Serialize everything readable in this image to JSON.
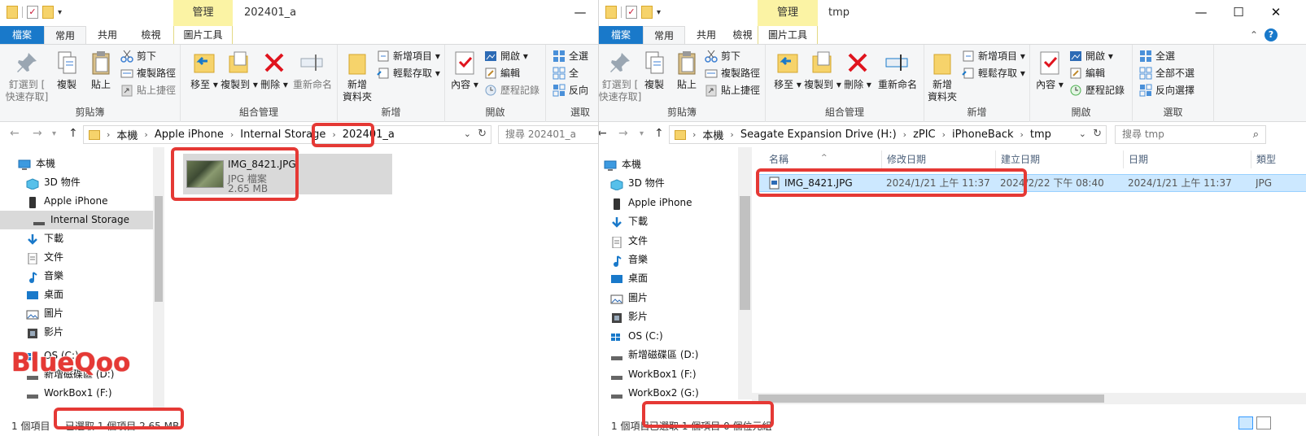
{
  "colors": {
    "accent": "#1979ca",
    "manage_bg": "#fbf3a4",
    "highlight": "#e53935",
    "selection": "#cce8ff"
  },
  "watermark": "BlueQoo",
  "common": {
    "tab_file": "檔案",
    "tab_home": "常用",
    "tab_share": "共用",
    "tab_view": "檢視",
    "tab_picture_tools": "圖片工具",
    "manage": "管理",
    "clipboard": {
      "pin": "釘選到 [",
      "pin2": "快速存取]",
      "copy": "複製",
      "paste": "貼上",
      "cut": "剪下",
      "copy_path": "複製路徑",
      "paste_shortcut": "貼上捷徑",
      "label": "剪貼簿"
    },
    "organize": {
      "move_to": "移至",
      "copy_to": "複製到",
      "delete": "刪除",
      "rename": "重新命名",
      "label": "組合管理"
    },
    "new": {
      "new_folder": "新增",
      "new_folder2": "資料夾",
      "new_item": "新增項目",
      "easy_access": "輕鬆存取",
      "label": "新增"
    },
    "open": {
      "properties": "內容",
      "open": "開啟",
      "edit": "編輯",
      "history": "歷程記錄",
      "label": "開啟"
    },
    "select": {
      "select_all": "全選",
      "select_none": "全部不選",
      "invert": "反向選擇",
      "label": "選取"
    },
    "nav": {
      "this_pc": "本機",
      "3d": "3D 物件",
      "iphone": "Apple iPhone",
      "internal": "Internal Storage",
      "downloads": "下載",
      "documents": "文件",
      "music": "音樂",
      "desktop": "桌面",
      "pictures": "圖片",
      "videos": "影片",
      "os_c": "OS (C:)",
      "new_vol_d": "新增磁碟區 (D:)",
      "workbox1": "WorkBox1 (F:)",
      "workbox2": "WorkBox2 (G:)"
    },
    "icons": [
      "pin-icon",
      "copy-icon",
      "paste-icon",
      "scissors-icon",
      "copy-path-icon",
      "paste-shortcut-icon",
      "move-to-icon",
      "copy-to-icon",
      "delete-icon",
      "rename-icon",
      "new-folder-icon",
      "new-item-icon",
      "easy-access-icon",
      "properties-icon",
      "open-icon",
      "edit-icon",
      "history-icon",
      "select-all-icon",
      "select-none-icon",
      "invert-selection-icon",
      "computer-icon",
      "folder-icon",
      "search-icon",
      "refresh-icon",
      "file-icon"
    ]
  },
  "left": {
    "title": "202401_a",
    "select_all_partial": "全選",
    "select_label_partial": "選取",
    "invert_partial": "反向",
    "select_none_partial": "全",
    "address": [
      "本機",
      "Apple iPhone",
      "Internal Storage",
      "202401_a"
    ],
    "search_placeholder": "搜尋 202401_a",
    "file": {
      "name": "IMG_8421.JPG",
      "type": "JPG 檔案",
      "size": "2.65 MB"
    },
    "status_count": "1 個項目",
    "status_selected": "已選取 1 個項目  2.65 MB"
  },
  "right": {
    "title": "tmp",
    "address": [
      "本機",
      "Seagate Expansion Drive (H:)",
      "zPIC",
      "iPhoneBack",
      "tmp"
    ],
    "search_placeholder": "搜尋 tmp",
    "columns": [
      "名稱",
      "修改日期",
      "建立日期",
      "日期",
      "類型"
    ],
    "row": {
      "name": "IMG_8421.JPG",
      "modified": "2024/1/21 上午 11:37",
      "created": "2024/2/22 下午 08:40",
      "date": "2024/1/21 上午 11:37",
      "type": "JPG"
    },
    "status_count": "1 個項目",
    "status_selected": "已選取 1 個項目  0 個位元組"
  }
}
